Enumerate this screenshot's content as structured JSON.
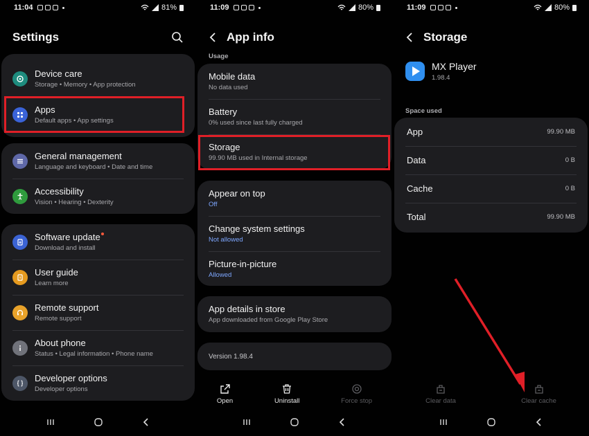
{
  "screen1": {
    "status": {
      "time": "11:04",
      "battery": "81%"
    },
    "title": "Settings",
    "items": [
      {
        "title": "Device care",
        "subtitle": "Storage  •  Memory  •  App protection",
        "color": "#1e8c7e"
      },
      {
        "title": "Apps",
        "subtitle": "Default apps  •  App settings",
        "color": "#3a63d8"
      },
      {
        "title": "General management",
        "subtitle": "Language and keyboard  •  Date and time",
        "color": "#5f68a8"
      },
      {
        "title": "Accessibility",
        "subtitle": "Vision  •  Hearing  •  Dexterity",
        "color": "#2f9b3d"
      },
      {
        "title": "Software update",
        "subtitle": "Download and install",
        "color": "#3b63d4"
      },
      {
        "title": "User guide",
        "subtitle": "Learn more",
        "color": "#e59a1f"
      },
      {
        "title": "Remote support",
        "subtitle": "Remote support",
        "color": "#e8a22a"
      },
      {
        "title": "About phone",
        "subtitle": "Status  •  Legal information  •  Phone name",
        "color": "#70727a"
      },
      {
        "title": "Developer options",
        "subtitle": "Developer options",
        "color": "#4d5667"
      }
    ]
  },
  "screen2": {
    "status": {
      "time": "11:09",
      "battery": "80%"
    },
    "title": "App info",
    "section": "Usage",
    "usage": [
      {
        "title": "Mobile data",
        "subtitle": "No data used"
      },
      {
        "title": "Battery",
        "subtitle": "0% used since last fully charged"
      },
      {
        "title": "Storage",
        "subtitle": "99.90 MB used in Internal storage"
      }
    ],
    "perms": [
      {
        "title": "Appear on top",
        "subtitle": "Off"
      },
      {
        "title": "Change system settings",
        "subtitle": "Not allowed"
      },
      {
        "title": "Picture-in-picture",
        "subtitle": "Allowed"
      }
    ],
    "store": {
      "title": "App details in store",
      "subtitle": "App downloaded from Google Play Store"
    },
    "version": "Version 1.98.4",
    "actions": {
      "open": "Open",
      "uninstall": "Uninstall",
      "force_stop": "Force stop"
    }
  },
  "screen3": {
    "status": {
      "time": "11:09",
      "battery": "80%"
    },
    "title": "Storage",
    "app_name": "MX Player",
    "app_version": "1.98.4",
    "section": "Space used",
    "rows": [
      {
        "label": "App",
        "value": "99.90 MB"
      },
      {
        "label": "Data",
        "value": "0 B"
      },
      {
        "label": "Cache",
        "value": "0 B"
      },
      {
        "label": "Total",
        "value": "99.90 MB"
      }
    ],
    "actions": {
      "clear_data": "Clear data",
      "clear_cache": "Clear cache"
    }
  },
  "colors": {
    "highlight": "#e01f27",
    "card": "#1d1d20",
    "link": "#7ea7ff",
    "app_icon": "#2f8ff0"
  }
}
